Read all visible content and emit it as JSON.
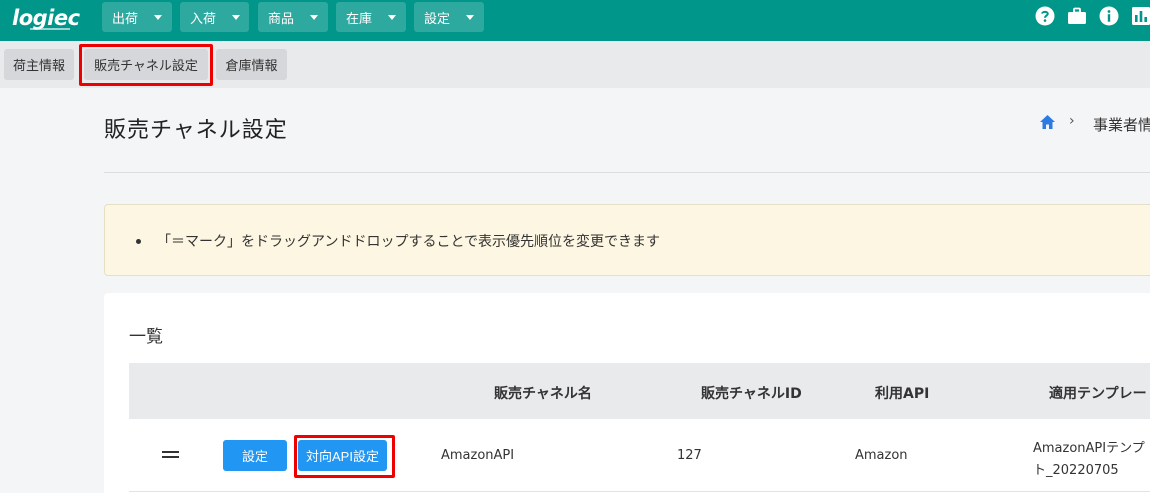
{
  "header": {
    "logo": "logiec",
    "menus": [
      {
        "label": "出荷"
      },
      {
        "label": "入荷"
      },
      {
        "label": "商品"
      },
      {
        "label": "在庫"
      },
      {
        "label": "設定"
      }
    ],
    "icons": [
      "help-icon",
      "briefcase-icon",
      "info-icon",
      "chart-icon"
    ]
  },
  "subtabs": [
    {
      "label": "荷主情報"
    },
    {
      "label": "販売チャネル設定"
    },
    {
      "label": "倉庫情報"
    }
  ],
  "page": {
    "title": "販売チャネル設定",
    "breadcrumb": "事業者情"
  },
  "notice": {
    "text": "「＝マーク」をドラッグアンドドロップすることで表示優先順位を変更できます"
  },
  "list": {
    "title": "一覧",
    "columns": [
      "販売チャネル名",
      "販売チャネルID",
      "利用API",
      "適用テンプレー"
    ],
    "rows": [
      {
        "settings_button": "設定",
        "api_button": "対向API設定",
        "channel_name": "AmazonAPI",
        "channel_id": "127",
        "api": "Amazon",
        "template_line1": "AmazonAPIテンプ",
        "template_line2": "ト_20220705"
      }
    ]
  },
  "colors": {
    "header": "#00968a",
    "button": "#2196f3",
    "highlight": "#ee0000",
    "notice_bg": "#fcf6e2"
  }
}
